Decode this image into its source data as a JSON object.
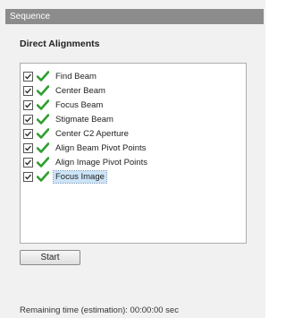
{
  "window": {
    "title": "Sequence"
  },
  "section": {
    "title": "Direct Alignments"
  },
  "alignments": {
    "items": [
      {
        "label": "Find Beam",
        "checked": true,
        "status_icon": "green-check-icon"
      },
      {
        "label": "Center Beam",
        "checked": true,
        "status_icon": "green-check-icon"
      },
      {
        "label": "Focus Beam",
        "checked": true,
        "status_icon": "green-check-icon"
      },
      {
        "label": "Stigmate Beam",
        "checked": true,
        "status_icon": "green-check-icon"
      },
      {
        "label": "Center C2 Aperture",
        "checked": true,
        "status_icon": "green-check-icon"
      },
      {
        "label": "Align Beam Pivot Points",
        "checked": true,
        "status_icon": "green-check-icon"
      },
      {
        "label": "Align Image Pivot Points",
        "checked": true,
        "status_icon": "green-check-icon"
      },
      {
        "label": "Focus Image",
        "checked": true,
        "status_icon": "green-check-icon",
        "selected": true
      }
    ]
  },
  "actions": {
    "start_label": "Start"
  },
  "status": {
    "remaining": "Remaining time (estimation): 00:00:00 sec"
  },
  "colors": {
    "title_bar": "#8c8c8c",
    "check_green": "#2f9e2f",
    "selection": "#cce4f7"
  }
}
